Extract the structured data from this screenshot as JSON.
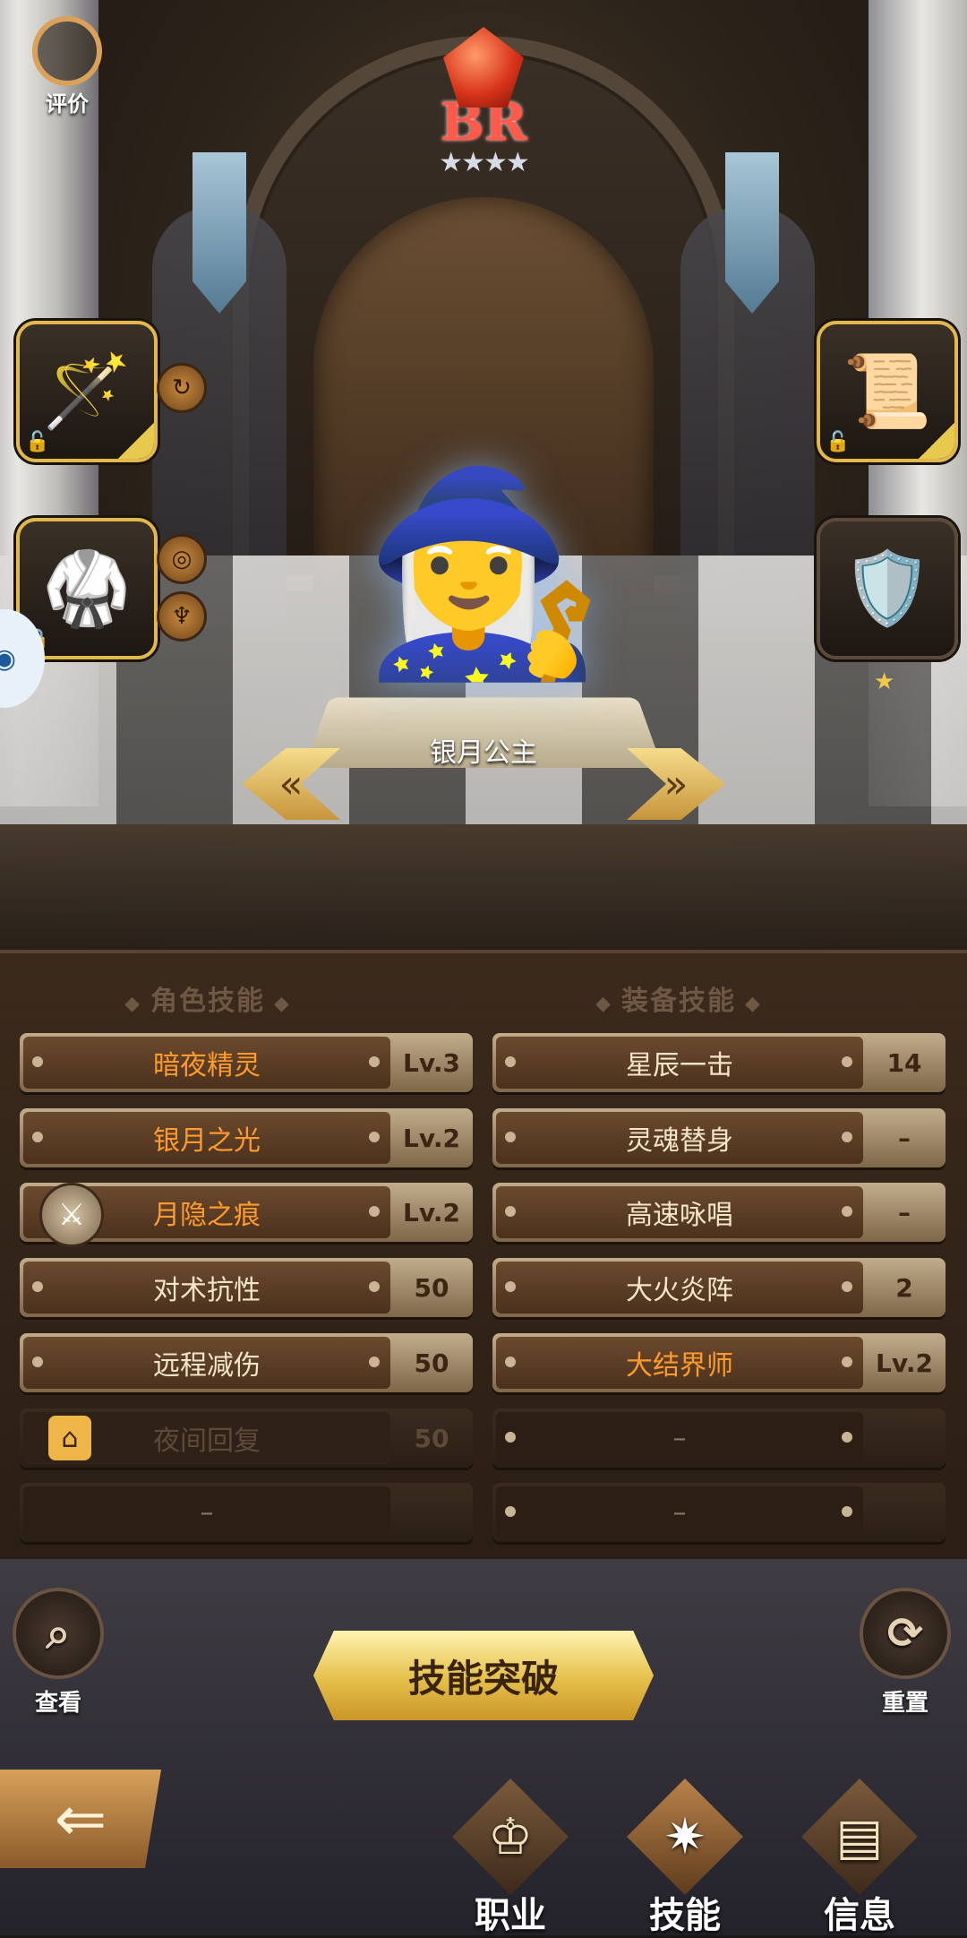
{
  "top": {
    "rate_label": "评价",
    "rank_text": "BR",
    "rank_stars": "★★★★"
  },
  "hero": {
    "name": "银月公主",
    "portrait_icon": "🧙‍♀️"
  },
  "equipment": {
    "weapon_icon": "🪄",
    "armor_icon": "🥋",
    "scroll_icon": "📜",
    "shield_icon": "🛡️"
  },
  "skills": {
    "role_title": "角色技能",
    "equip_title": "装备技能",
    "role_rows": [
      {
        "name": "暗夜精灵",
        "value": "Lv.3"
      },
      {
        "name": "银月之光",
        "value": "Lv.2"
      },
      {
        "name": "月隐之痕",
        "value": "Lv.2"
      },
      {
        "name": "对术抗性",
        "value": "50"
      },
      {
        "name": "远程减伤",
        "value": "50"
      },
      {
        "name": "夜间回复",
        "value": "50"
      },
      {
        "name": "–",
        "value": ""
      }
    ],
    "equip_rows": [
      {
        "name": "星辰一击",
        "value": "14"
      },
      {
        "name": "灵魂替身",
        "value": "–"
      },
      {
        "name": "高速咏唱",
        "value": "–"
      },
      {
        "name": "大火炎阵",
        "value": "2"
      },
      {
        "name": "大结界师",
        "value": "Lv.2"
      },
      {
        "name": "–",
        "value": ""
      },
      {
        "name": "–",
        "value": ""
      }
    ]
  },
  "actions": {
    "view_label": "查看",
    "reset_label": "重置",
    "breakthrough_label": "技能突破"
  },
  "tabs": {
    "job": "职业",
    "skill": "技能",
    "info": "信息"
  }
}
